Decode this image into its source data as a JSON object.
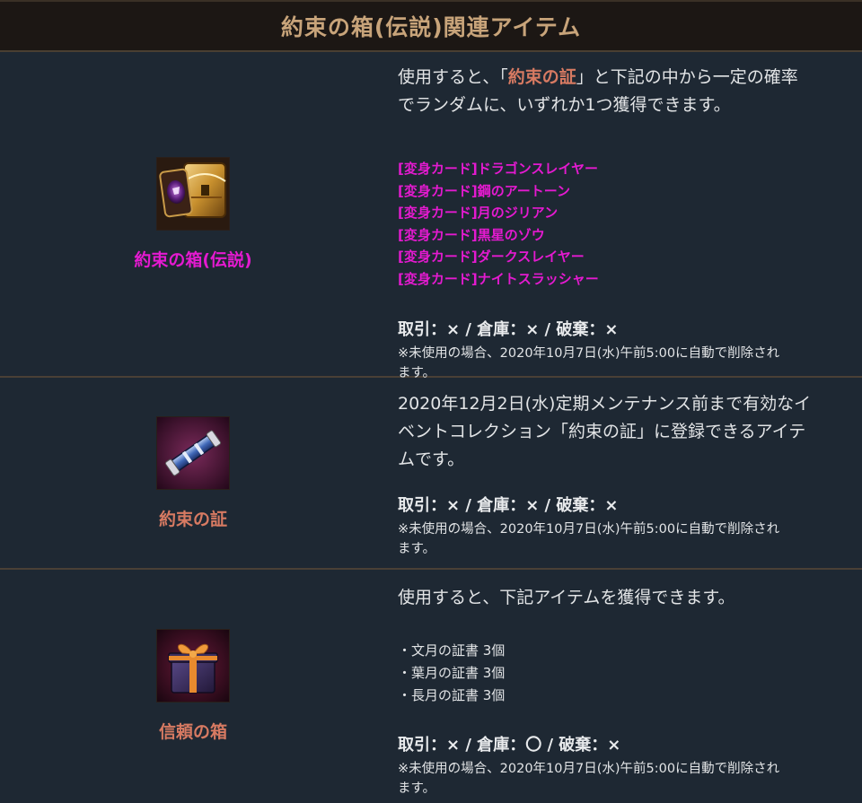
{
  "header": {
    "title": "約束の箱(伝説)関連アイテム"
  },
  "items": [
    {
      "name": "約束の箱(伝説)",
      "desc_line1_pre": "使用すると、「",
      "desc_line1_hl": "約束の証",
      "desc_line1_post": "」と下記の中から一定の確率",
      "desc_line2": "でランダムに、いずれか1つ獲得できます。",
      "list": [
        "[変身カード]ドラゴンスレイヤー",
        "[変身カード]鋼のアートーン",
        "[変身カード]月のジリアン",
        "[変身カード]黒星のゾウ",
        "[変身カード]ダークスレイヤー",
        "[変身カード]ナイトスラッシャー"
      ],
      "permissions": "取引：× / 倉庫：× / 破棄：×",
      "note_line1": "※未使用の場合、2020年10月7日(水)午前5:00に自動で削除され",
      "note_line2": "ます。",
      "icon": "treasure-chest-card-icon"
    },
    {
      "name": "約束の証",
      "desc_lines": [
        "2020年12月2日(水)定期メンテナンス前まで有効なイ",
        "ベントコレクション「約束の証」に登録できるアイテ",
        "ムです。"
      ],
      "permissions": "取引：× / 倉庫：× / 破棄：×",
      "note_line1": "※未使用の場合、2020年10月7日(水)午前5:00に自動で削除され",
      "note_line2": "ます。",
      "icon": "scroll-icon"
    },
    {
      "name": "信頼の箱",
      "desc_line1": "使用すると、下記アイテムを獲得できます。",
      "list": [
        "・文月の証書 3個",
        "・葉月の証書 3個",
        "・長月の証書 3個"
      ],
      "permissions": "取引：× / 倉庫：〇 / 破棄：×",
      "note_line1": "※未使用の場合、2020年10月7日(水)午前5:00に自動で削除され",
      "note_line2": "ます。",
      "icon": "gift-box-icon"
    }
  ],
  "colors": {
    "background": "#1e2833",
    "header_bg": "#1c1714",
    "header_text": "#c8a47a",
    "magenta": "#e41ad0",
    "salmon": "#d77a62",
    "divider": "#4a4036"
  }
}
